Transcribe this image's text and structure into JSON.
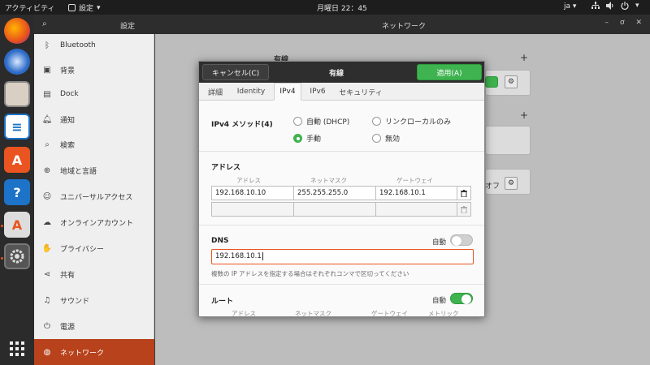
{
  "topbar": {
    "activities": "アクティビティ",
    "app_name": "設定",
    "clock": "月曜日 22：45",
    "lang": "ja ▾"
  },
  "header": {
    "left_title": "設定",
    "right_title": "ネットワーク"
  },
  "sidebar": {
    "items": [
      {
        "label": "Bluetooth",
        "icon": "bluetooth-icon"
      },
      {
        "label": "背景",
        "icon": "background-icon"
      },
      {
        "label": "Dock",
        "icon": "dock-icon"
      },
      {
        "label": "通知",
        "icon": "bell-icon"
      },
      {
        "label": "検索",
        "icon": "search-icon"
      },
      {
        "label": "地域と言語",
        "icon": "globe-icon"
      },
      {
        "label": "ユニバーサルアクセス",
        "icon": "accessibility-icon"
      },
      {
        "label": "オンラインアカウント",
        "icon": "online-accounts-icon"
      },
      {
        "label": "プライバシー",
        "icon": "privacy-icon"
      },
      {
        "label": "共有",
        "icon": "share-icon"
      },
      {
        "label": "サウンド",
        "icon": "sound-icon"
      },
      {
        "label": "電源",
        "icon": "power-icon"
      },
      {
        "label": "ネットワーク",
        "icon": "network-icon",
        "active": true
      }
    ]
  },
  "main": {
    "wired_label": "有線",
    "vpn_off_label": "オフ",
    "plus": "+"
  },
  "dialog": {
    "cancel": "キャンセル(C)",
    "title": "有線",
    "apply": "適用(A)",
    "tabs": [
      "詳細",
      "Identity",
      "IPv4",
      "IPv6",
      "セキュリティ"
    ],
    "active_tab": "IPv4",
    "ipv4_method_label": "IPv4 メソッド(4)",
    "methods": {
      "auto_dhcp": "自動 (DHCP)",
      "link_local": "リンクローカルのみ",
      "manual": "手動",
      "disabled": "無効"
    },
    "address_section": "アドレス",
    "columns": {
      "address": "アドレス",
      "netmask": "ネットマスク",
      "gateway": "ゲートウェイ",
      "metric": "メトリック"
    },
    "address_rows": [
      {
        "address": "192.168.10.10",
        "netmask": "255.255.255.0",
        "gateway": "192.168.10.1"
      }
    ],
    "dns_label": "DNS",
    "auto_label": "自動",
    "dns_value": "192.168.10.1",
    "dns_hint": "複数の IP アドレスを指定する場合はそれぞれコンマで区切ってください",
    "route_label": "ルート",
    "route_auto_label": "自動"
  },
  "colors": {
    "accent": "#e95420",
    "active_sidebar": "#b8421c",
    "apply_green": "#3eb34f"
  }
}
